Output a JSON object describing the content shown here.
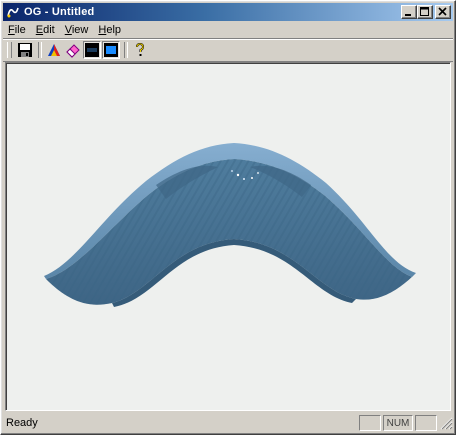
{
  "window": {
    "title": "OG - Untitled"
  },
  "caption": {
    "minimize_icon": "minimize-icon",
    "maximize_icon": "maximize-icon",
    "close_icon": "close-icon"
  },
  "menu": {
    "items": [
      {
        "underline": "F",
        "rest": "ile"
      },
      {
        "underline": "E",
        "rest": "dit"
      },
      {
        "underline": "V",
        "rest": "iew"
      },
      {
        "underline": "H",
        "rest": "elp"
      }
    ]
  },
  "toolbar": {
    "buttons": [
      {
        "icon": "save-disk-icon",
        "pressed": false
      },
      {
        "icon": "color-triangle-icon",
        "pressed": false
      },
      {
        "icon": "eraser-icon",
        "pressed": false
      },
      {
        "icon": "fill-mode-icon",
        "pressed": true
      },
      {
        "icon": "wireframe-mode-icon",
        "pressed": true
      },
      {
        "icon": "help-question-icon",
        "pressed": false
      }
    ]
  },
  "viewport": {
    "surface_color": "#5b86a8",
    "background_color": "#eef0ee"
  },
  "status": {
    "text": "Ready",
    "indicator_1": "",
    "indicator_2": "NUM",
    "indicator_3": ""
  }
}
